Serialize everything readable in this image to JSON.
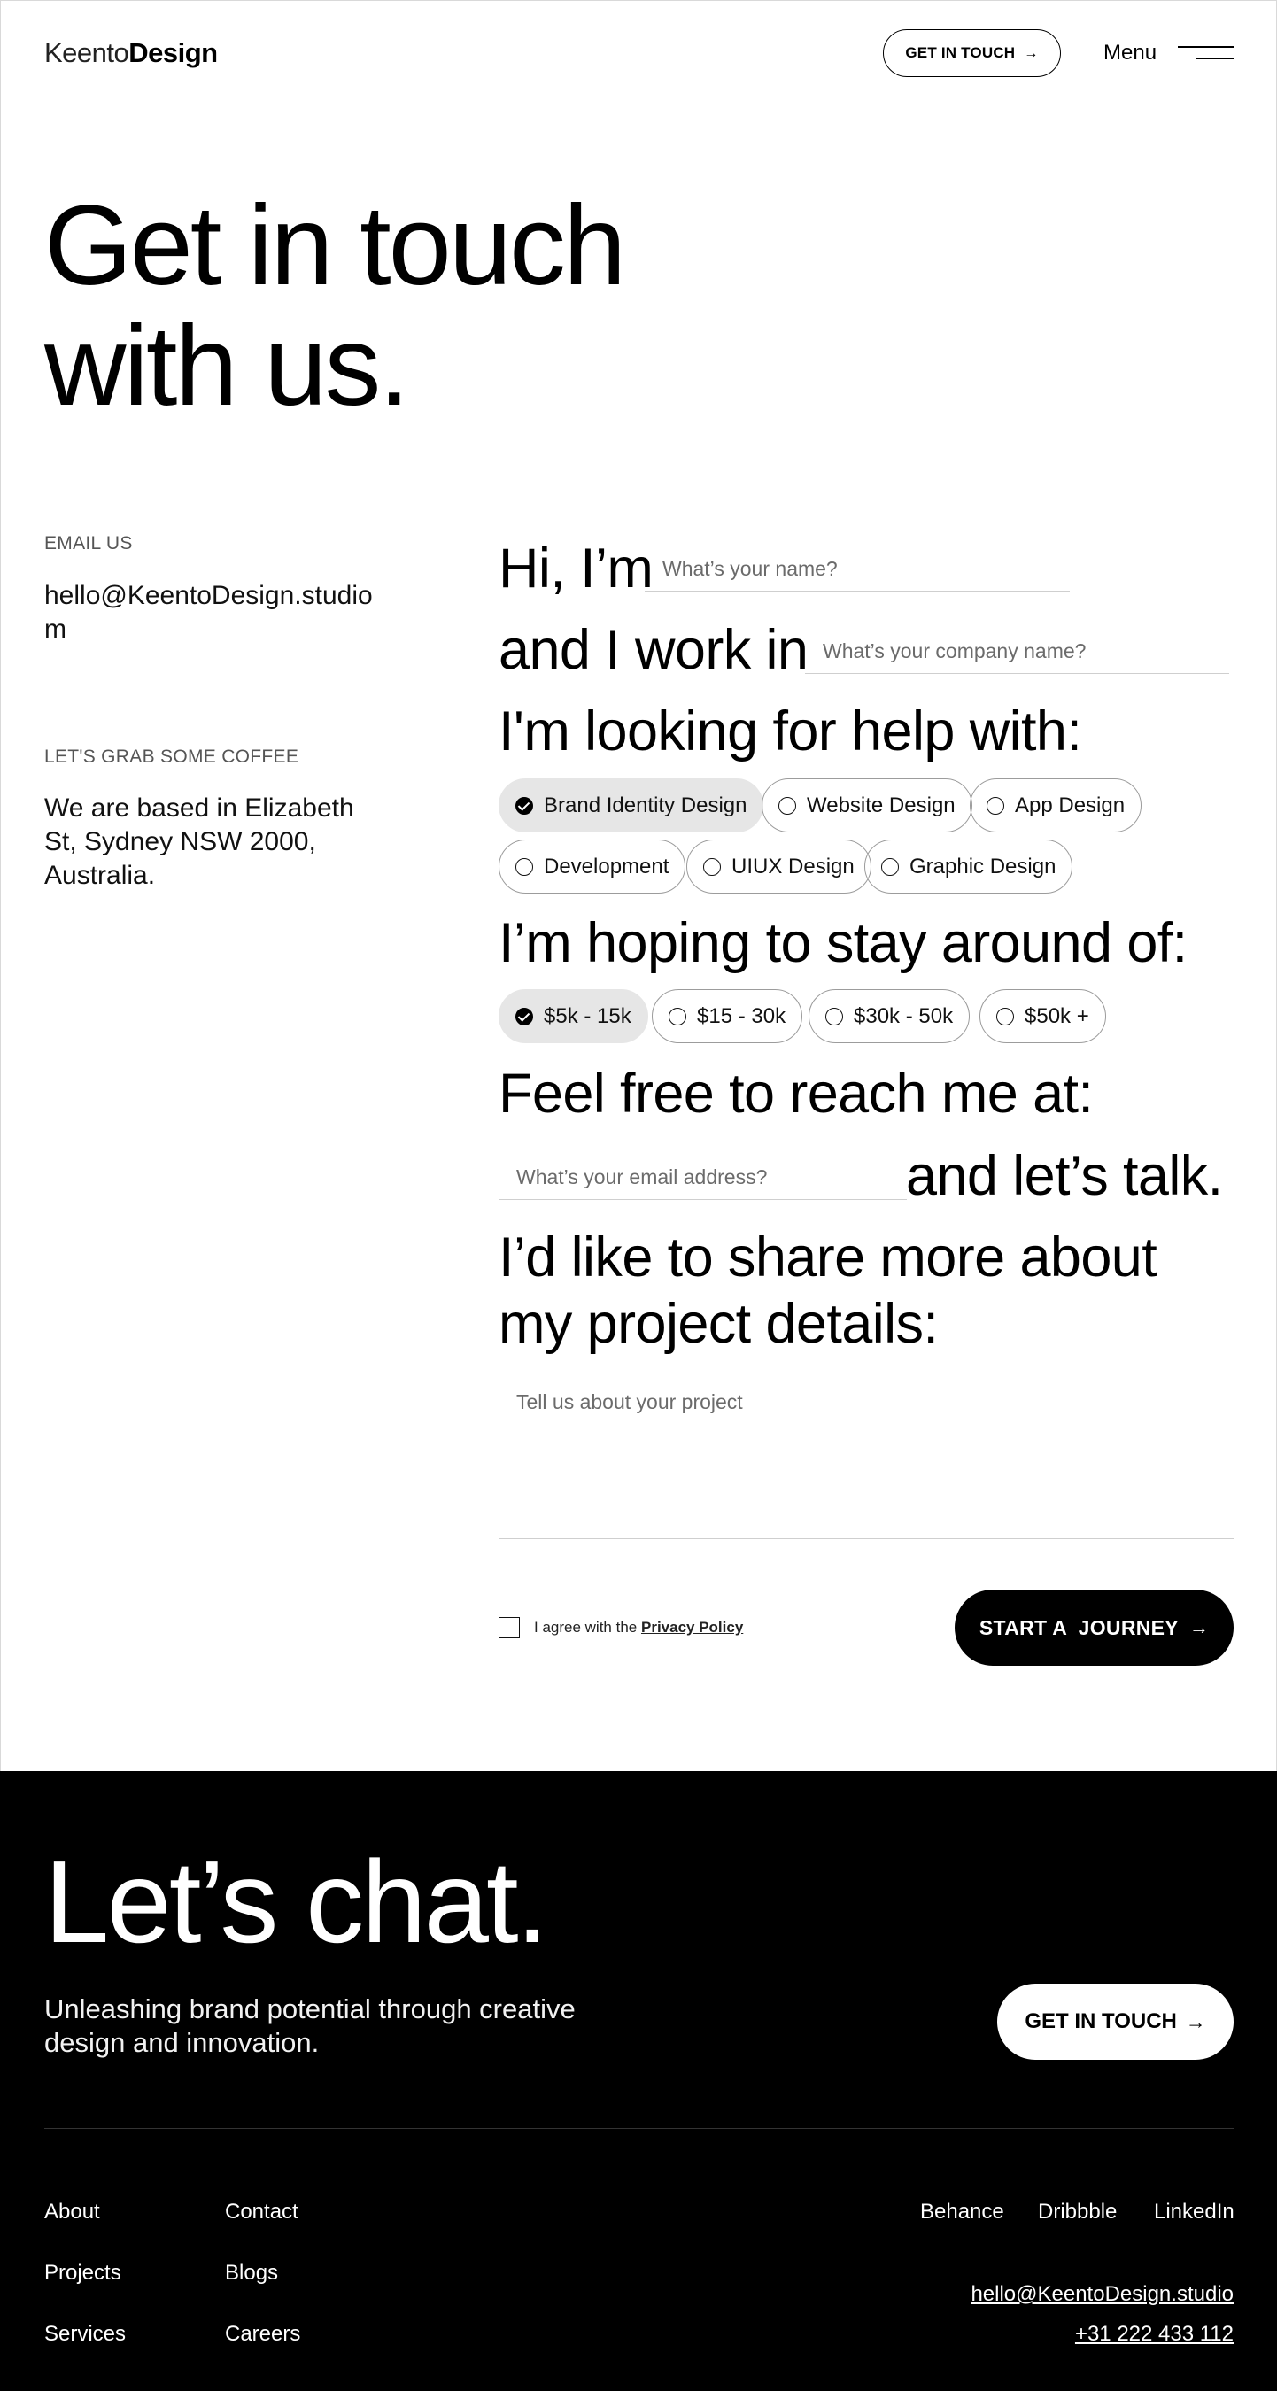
{
  "header": {
    "logo_light": "Keento",
    "logo_bold": "Design",
    "cta_label": "GET IN TOUCH",
    "menu_label": "Menu"
  },
  "hero": {
    "line1": "Get in touch",
    "line2": "with us."
  },
  "contact": {
    "email_label": "EMAIL US",
    "email_value": "hello@KeentoDesign.studiom",
    "coffee_label": "LET'S GRAB SOME COFFEE",
    "address": "We are based in Elizabeth St, Sydney NSW 2000, Australia."
  },
  "form": {
    "name_prompt": "Hi, I’m",
    "name_placeholder": "What’s your name?",
    "company_prompt": "and I work in",
    "company_placeholder": "What’s your company name?",
    "help_prompt": "I'm looking for help with:",
    "services": [
      {
        "label": "Brand Identity Design",
        "selected": true
      },
      {
        "label": "Website Design",
        "selected": false
      },
      {
        "label": "App Design",
        "selected": false
      },
      {
        "label": "Development",
        "selected": false
      },
      {
        "label": "UIUX Design",
        "selected": false
      },
      {
        "label": "Graphic Design",
        "selected": false
      }
    ],
    "budget_prompt": "I’m hoping to stay around of:",
    "budgets": [
      {
        "label": "$5k - 15k",
        "selected": true
      },
      {
        "label": "$15 - 30k",
        "selected": false
      },
      {
        "label": "$30k - 50k",
        "selected": false
      },
      {
        "label": "$50k +",
        "selected": false
      }
    ],
    "reach_prompt": "Feel free to reach me at:",
    "email_placeholder": "What’s your email address?",
    "talk_suffix": "and let’s talk.",
    "details_line1": "I’d like to share more about",
    "details_line2": "my project details:",
    "details_placeholder": "Tell us about your project",
    "agree_text": "I agree with the",
    "privacy_link": "Privacy Policy",
    "submit_label": "START A  JOURNEY"
  },
  "footer": {
    "heading": "Let’s chat.",
    "tagline": "Unleashing brand potential through creative design and innovation.",
    "cta_label": "GET IN TOUCH",
    "col1": [
      "About",
      "Projects",
      "Services"
    ],
    "col2": [
      "Contact",
      "Blogs",
      "Careers"
    ],
    "social": [
      "Behance",
      "Dribbble",
      "LinkedIn"
    ],
    "email": "hello@KeentoDesign.studio",
    "phone": "+31 222 433 112"
  },
  "icons": {
    "arrow": "arrow-right-icon",
    "check": "check-circle-icon",
    "menu": "hamburger-menu-icon"
  }
}
